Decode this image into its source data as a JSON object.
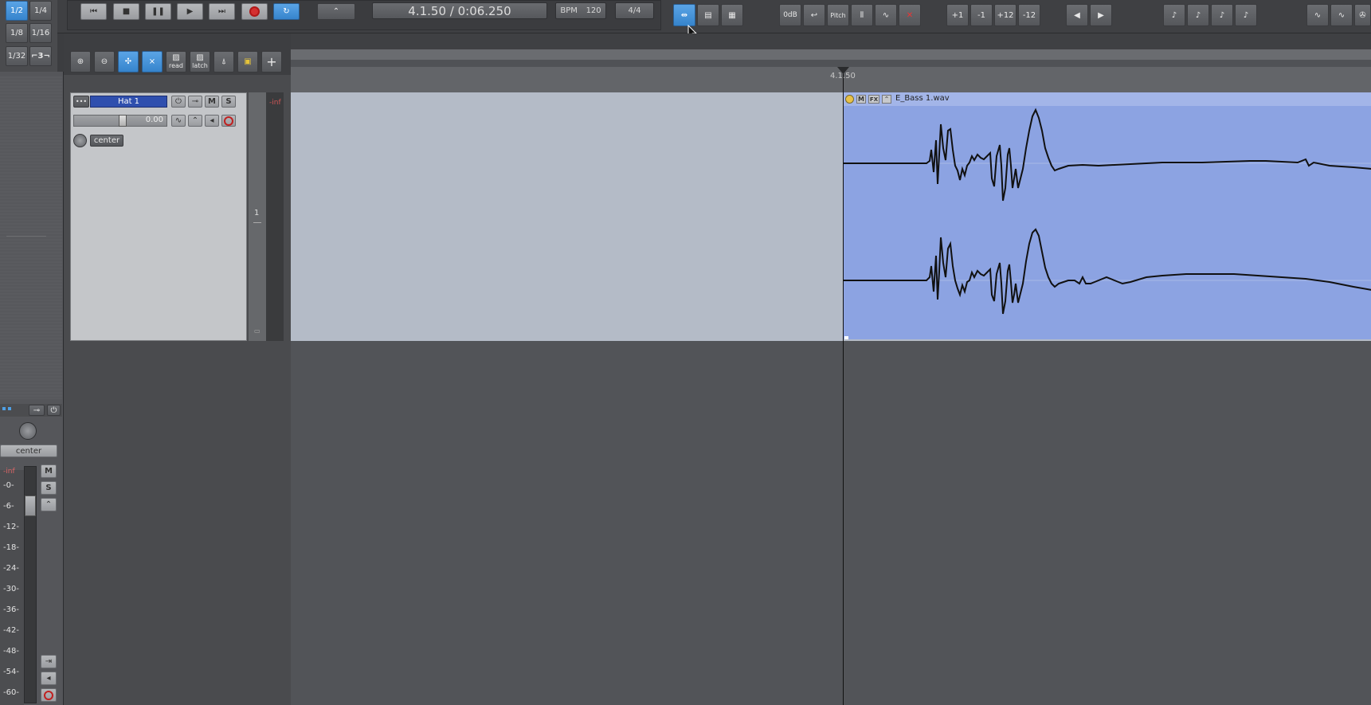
{
  "grid": {
    "divisions": [
      "1/2",
      "1/4",
      "1/8",
      "1/16",
      "1/32",
      "⌐3¬"
    ],
    "active": "1/2"
  },
  "transport": {
    "time_display": "4.1.50 / 0:06.250",
    "bpm_label": "BPM",
    "bpm_value": "120",
    "time_signature": "4/4"
  },
  "toolbar": {
    "zero_db": "0dB",
    "pitch": "Pitch",
    "plus1": "+1",
    "minus1": "-1",
    "plus12": "+12",
    "minus12": "-12"
  },
  "tcp_toolbar": {
    "read": "read",
    "latch": "latch"
  },
  "track": {
    "name": "Hat 1",
    "mute": "M",
    "solo": "S",
    "volume": "0.00",
    "pan": "center",
    "meter": "-inf",
    "number": "1"
  },
  "master": {
    "pan": "center",
    "meter": "-inf",
    "mute": "M",
    "solo": "S",
    "db_scale": [
      "-0-",
      "-6-",
      "-12-",
      "-18-",
      "-24-",
      "-30-",
      "-36-",
      "-42-",
      "-48-",
      "-54-",
      "-60-"
    ]
  },
  "ruler": {
    "position": "4.1.50"
  },
  "item": {
    "name": "E_Bass 1.wav",
    "badges": [
      "M",
      "FX"
    ]
  },
  "colors": {
    "accent_blue": "#3684cc",
    "item_blue": "#8ca3e2",
    "lane": "#b4bbc7",
    "track_name_bg": "#2f4fae"
  }
}
